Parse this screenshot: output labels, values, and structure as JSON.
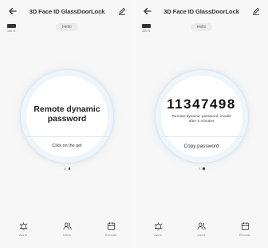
{
  "screens": [
    {
      "header": {
        "title": "3D Face ID GlassDoorLock"
      },
      "battery": {
        "percent_label": "100 %",
        "level": 1.0
      },
      "greeting": "Hello",
      "panel": {
        "title": "Remote dynamic password",
        "button_label": "Click on the get"
      },
      "pager": {
        "page_count": 2,
        "active_index": 1
      },
      "tabs": [
        {
          "label": "Alarm",
          "icon": "alarm-icon"
        },
        {
          "label": "Users",
          "icon": "users-icon"
        },
        {
          "label": "Records",
          "icon": "records-icon"
        }
      ]
    },
    {
      "header": {
        "title": "3D Face ID GlassDoorLock"
      },
      "battery": {
        "percent_label": "100 %",
        "level": 1.0
      },
      "greeting": "Hello",
      "panel": {
        "code": "11347498",
        "note": "Remote dynamic password, invalid after 5 minutes",
        "button_label": "Copy password"
      },
      "pager": {
        "page_count": 2,
        "active_index": 1
      },
      "tabs": [
        {
          "label": "Alarm",
          "icon": "alarm-icon"
        },
        {
          "label": "Users",
          "icon": "users-icon"
        },
        {
          "label": "Records",
          "icon": "records-icon"
        }
      ]
    }
  ],
  "colors": {
    "background": "#f7f7f7",
    "ring_outer": "#eef5fb",
    "text": "#222222"
  }
}
